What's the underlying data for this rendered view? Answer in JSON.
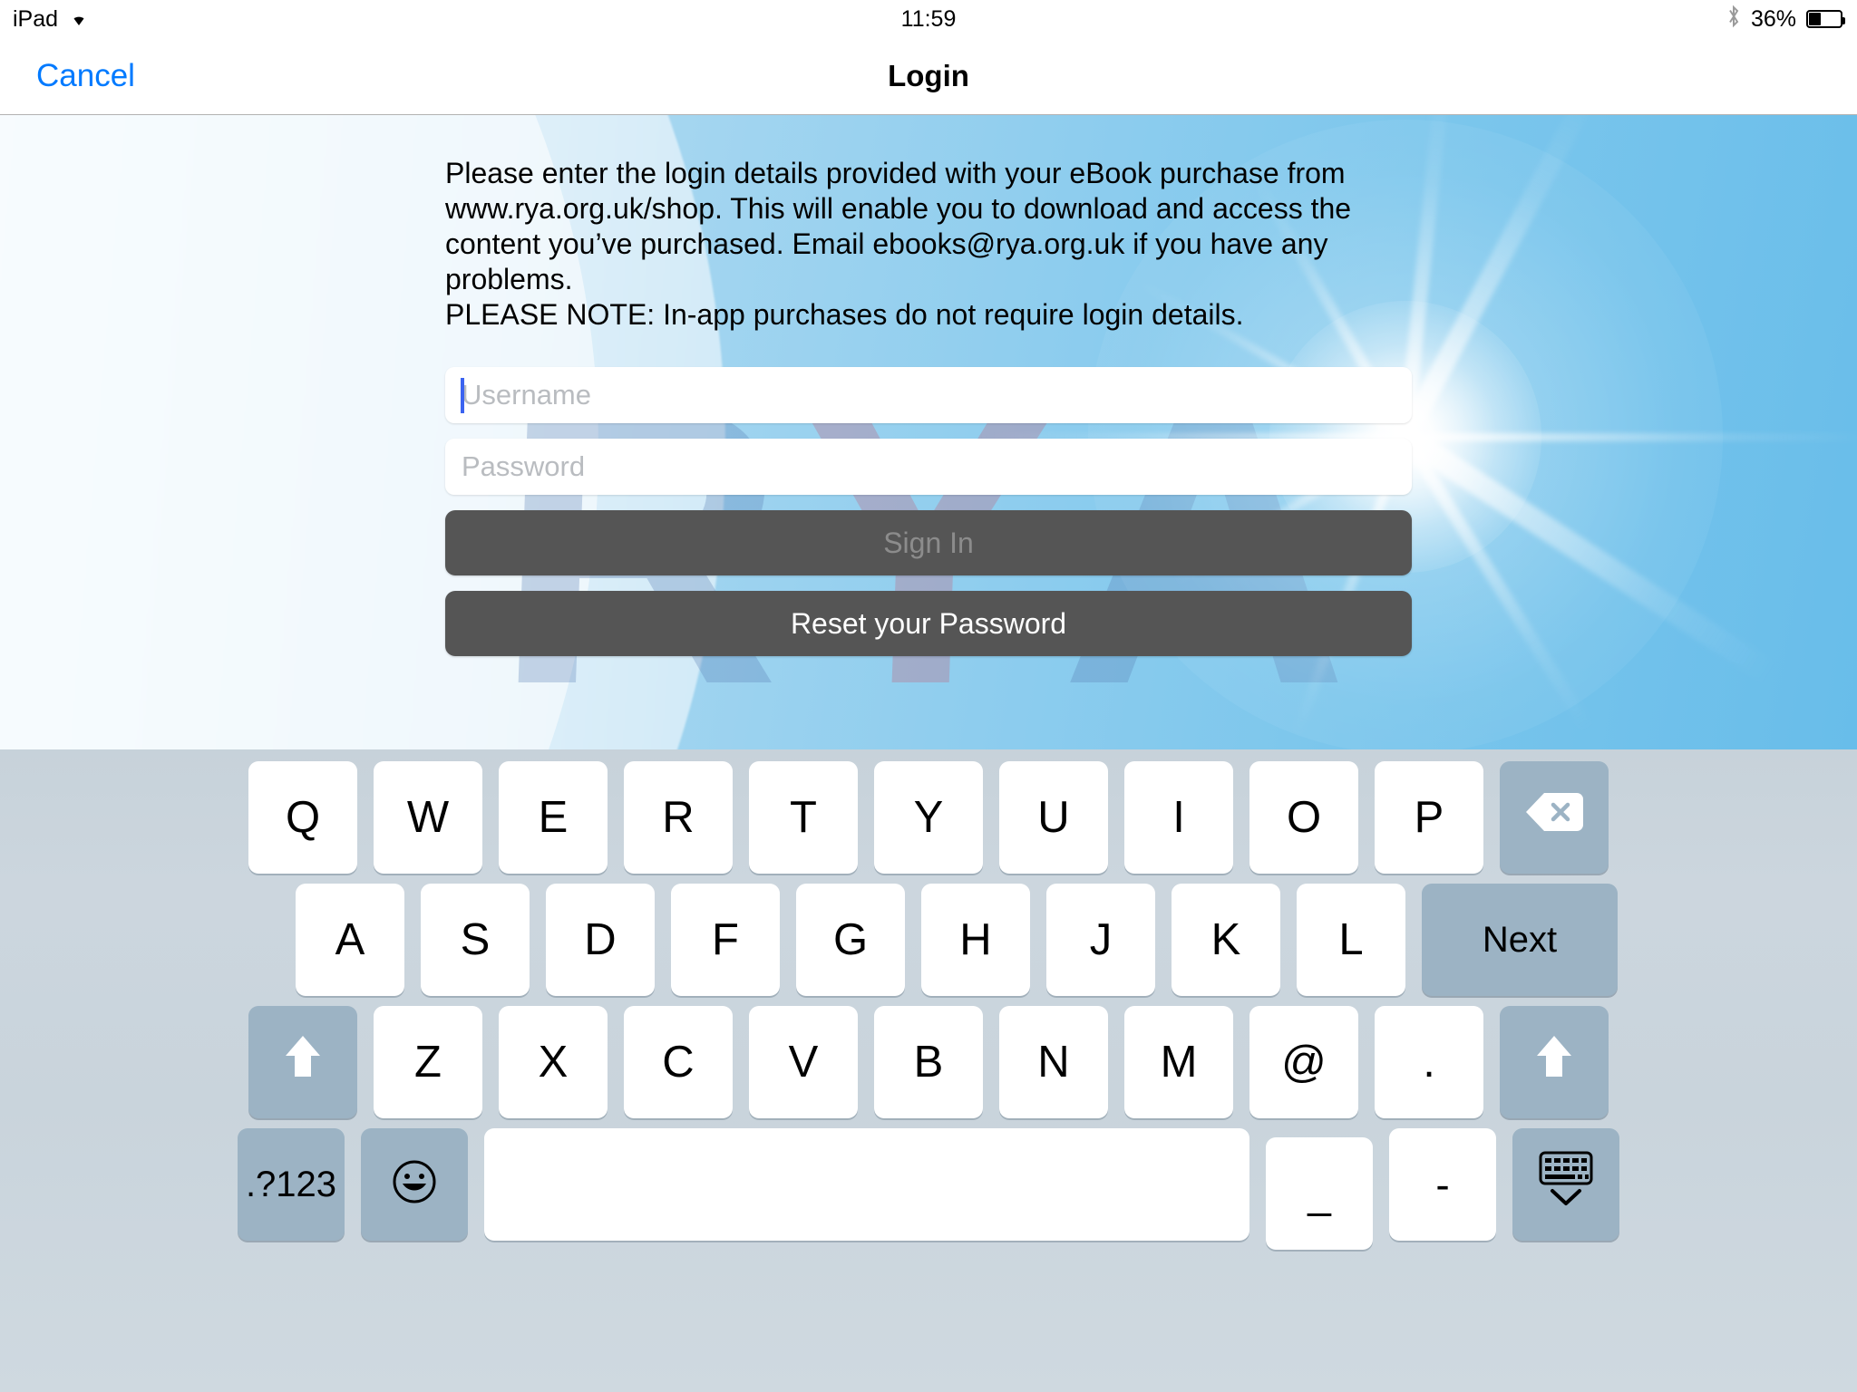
{
  "status_bar": {
    "device_label": "iPad",
    "wifi_icon": "wifi-icon",
    "time": "11:59",
    "bluetooth_icon": "bluetooth-icon",
    "battery_percent": "36%",
    "battery_level": 36
  },
  "nav_bar": {
    "cancel_label": "Cancel",
    "title": "Login"
  },
  "main": {
    "instructions": "Please enter the login details provided with your eBook purchase from www.rya.org.uk/shop. This will enable you to download and access the content you’ve purchased. Email ebooks@rya.org.uk if you have any problems.\n PLEASE NOTE: In-app purchases do not require login details.",
    "username_placeholder": "Username",
    "username_value": "",
    "password_placeholder": "Password",
    "password_value": "",
    "sign_in_label": "Sign In",
    "reset_password_label": "Reset your Password",
    "watermark": {
      "letter_1": "R",
      "letter_2": "Y",
      "letter_3": "A"
    }
  },
  "colors": {
    "accent_blue": "#007aff",
    "caret_blue": "#3b63f0",
    "button_gray": "#555555",
    "button_disabled_text": "#8c8c8c",
    "placeholder_gray": "#b9bcc0",
    "keyboard_bg": "#c9d4dc",
    "key_white": "#ffffff",
    "key_dark": "#9cb3c4",
    "sky_light": "#eaf5fb",
    "sky_dark": "#68bdea"
  },
  "keyboard": {
    "row1": [
      {
        "label": "Q",
        "name": "key-q",
        "style": "light"
      },
      {
        "label": "W",
        "name": "key-w",
        "style": "light"
      },
      {
        "label": "E",
        "name": "key-e",
        "style": "light"
      },
      {
        "label": "R",
        "name": "key-r",
        "style": "light"
      },
      {
        "label": "T",
        "name": "key-t",
        "style": "light"
      },
      {
        "label": "Y",
        "name": "key-y",
        "style": "light"
      },
      {
        "label": "U",
        "name": "key-u",
        "style": "light"
      },
      {
        "label": "I",
        "name": "key-i",
        "style": "light"
      },
      {
        "label": "O",
        "name": "key-o",
        "style": "light"
      },
      {
        "label": "P",
        "name": "key-p",
        "style": "light"
      }
    ],
    "backspace_icon": "backspace-icon",
    "row2": [
      {
        "label": "A",
        "name": "key-a",
        "style": "light"
      },
      {
        "label": "S",
        "name": "key-s",
        "style": "light"
      },
      {
        "label": "D",
        "name": "key-d",
        "style": "light"
      },
      {
        "label": "F",
        "name": "key-f",
        "style": "light"
      },
      {
        "label": "G",
        "name": "key-g",
        "style": "light"
      },
      {
        "label": "H",
        "name": "key-h",
        "style": "light"
      },
      {
        "label": "J",
        "name": "key-j",
        "style": "light"
      },
      {
        "label": "K",
        "name": "key-k",
        "style": "light"
      },
      {
        "label": "L",
        "name": "key-l",
        "style": "light"
      }
    ],
    "next_label": "Next",
    "row3": [
      {
        "label": "Z",
        "name": "key-z",
        "style": "light"
      },
      {
        "label": "X",
        "name": "key-x",
        "style": "light"
      },
      {
        "label": "C",
        "name": "key-c",
        "style": "light"
      },
      {
        "label": "V",
        "name": "key-v",
        "style": "light"
      },
      {
        "label": "B",
        "name": "key-b",
        "style": "light"
      },
      {
        "label": "N",
        "name": "key-n",
        "style": "light"
      },
      {
        "label": "M",
        "name": "key-m",
        "style": "light"
      },
      {
        "label": "@",
        "name": "key-at",
        "style": "light"
      },
      {
        "label": ".",
        "name": "key-period",
        "style": "light"
      }
    ],
    "shift_left_icon": "shift-icon",
    "shift_right_icon": "shift-icon",
    "numbers_label": ".?123",
    "emoji_icon": "emoji-icon",
    "space_label": "",
    "underscore_label": "_",
    "hyphen_label": "-",
    "dismiss_keyboard_icon": "dismiss-keyboard-icon"
  }
}
